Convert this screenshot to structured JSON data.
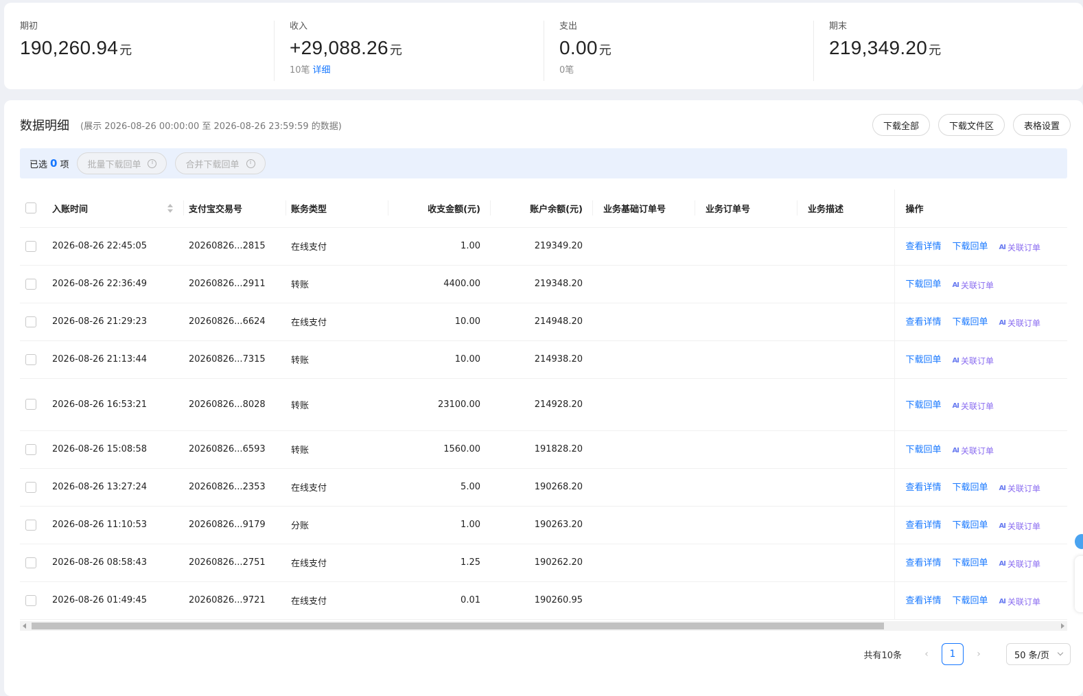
{
  "summary": [
    {
      "label": "期初",
      "value": "190,260.94",
      "unit": "元",
      "sub": "",
      "link": ""
    },
    {
      "label": "收入",
      "value": "+29,088.26",
      "unit": "元",
      "sub": "10笔",
      "link": "详细"
    },
    {
      "label": "支出",
      "value": "0.00",
      "unit": "元",
      "sub": "0笔",
      "link": ""
    },
    {
      "label": "期末",
      "value": "219,349.20",
      "unit": "元",
      "sub": "",
      "link": ""
    }
  ],
  "detail": {
    "title": "数据明细",
    "range": "(展示 2026-08-26 00:00:00 至 2026-08-26 23:59:59 的数据)",
    "buttons": {
      "download_all": "下载全部",
      "download_files": "下载文件区",
      "table_settings": "表格设置"
    }
  },
  "selection": {
    "prefix": "已选",
    "count": "0",
    "suffix": "项",
    "batch_download": "批量下载回单",
    "merge_download": "合并下载回单"
  },
  "table": {
    "headers": {
      "time": "入账时间",
      "trade_no": "支付宝交易号",
      "type": "账务类型",
      "amount": "收支金额(元)",
      "balance": "账户余额(元)",
      "base_order": "业务基础订单号",
      "order": "业务订单号",
      "desc": "业务描述",
      "ops": "操作"
    },
    "ops_labels": {
      "detail": "查看详情",
      "download": "下载回单",
      "link_order": "关联订单",
      "ai_icon": "AI"
    },
    "rows": [
      {
        "time": "2026-08-26 22:45:05",
        "trade_no": "20260826...2815",
        "type": "在线支付",
        "amount": "1.00",
        "balance": "219349.20",
        "has_detail": true
      },
      {
        "time": "2026-08-26 22:36:49",
        "trade_no": "20260826...2911",
        "type": "转账",
        "amount": "4400.00",
        "balance": "219348.20",
        "has_detail": false
      },
      {
        "time": "2026-08-26 21:29:23",
        "trade_no": "20260826...6624",
        "type": "在线支付",
        "amount": "10.00",
        "balance": "214948.20",
        "has_detail": true
      },
      {
        "time": "2026-08-26 21:13:44",
        "trade_no": "20260826...7315",
        "type": "转账",
        "amount": "10.00",
        "balance": "214938.20",
        "has_detail": false
      },
      {
        "time": "2026-08-26 16:53:21",
        "trade_no": "20260826...8028",
        "type": "转账",
        "amount": "23100.00",
        "balance": "214928.20",
        "has_detail": false
      },
      {
        "time": "2026-08-26 15:08:58",
        "trade_no": "20260826...6593",
        "type": "转账",
        "amount": "1560.00",
        "balance": "191828.20",
        "has_detail": false
      },
      {
        "time": "2026-08-26 13:27:24",
        "trade_no": "20260826...2353",
        "type": "在线支付",
        "amount": "5.00",
        "balance": "190268.20",
        "has_detail": true
      },
      {
        "time": "2026-08-26 11:10:53",
        "trade_no": "20260826...9179",
        "type": "分账",
        "amount": "1.00",
        "balance": "190263.20",
        "has_detail": true
      },
      {
        "time": "2026-08-26 08:58:43",
        "trade_no": "20260826...2751",
        "type": "在线支付",
        "amount": "1.25",
        "balance": "190262.20",
        "has_detail": true
      },
      {
        "time": "2026-08-26 01:49:45",
        "trade_no": "20260826...9721",
        "type": "在线支付",
        "amount": "0.01",
        "balance": "190260.95",
        "has_detail": true
      }
    ]
  },
  "pager": {
    "total": "共有10条",
    "current": "1",
    "page_size": "50 条/页"
  },
  "colors": {
    "accent": "#1677ff",
    "link_order": "#8a6cf0"
  }
}
